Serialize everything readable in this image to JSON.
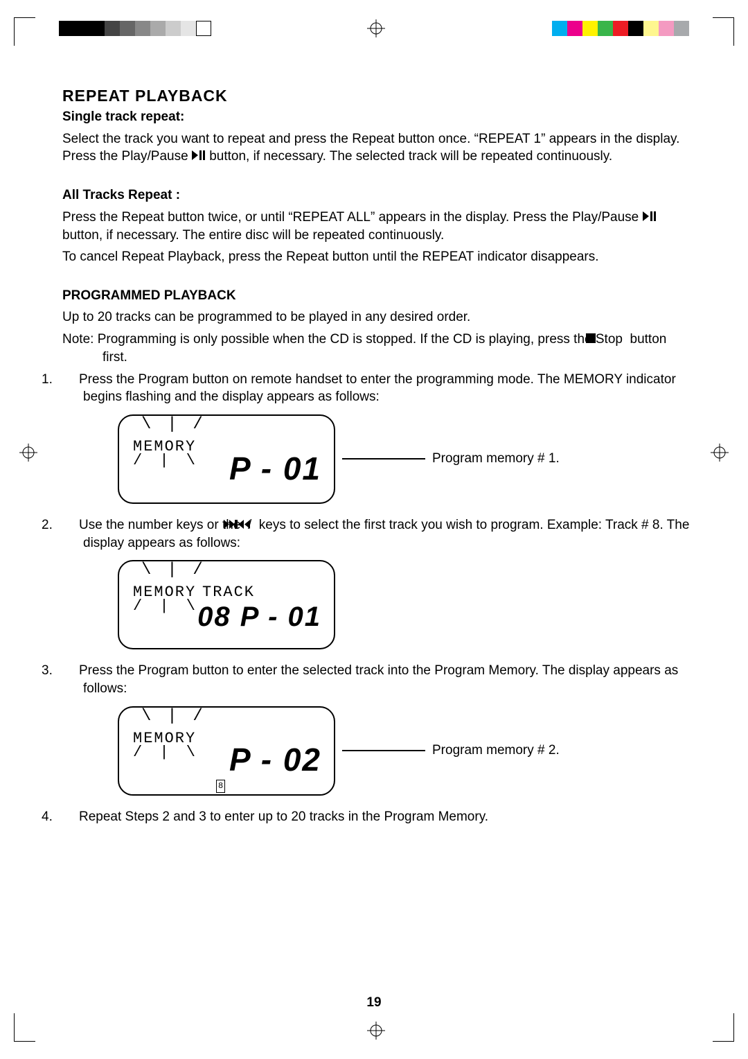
{
  "page_number": "19",
  "heading": "REPEAT PLAYBACK",
  "single": {
    "title": "Single track repeat:",
    "body_a": "Select the track you want to repeat and press the Repeat button once. “REPEAT 1” appears in the display.  Press the Play/Pause ",
    "body_b": " button, if necessary.  The selected track will be repeated continuously."
  },
  "all": {
    "title": "All Tracks Repeat :",
    "body_a": "Press the Repeat button twice, or until “REPEAT ALL” appears in the display. Press the Play/Pause ",
    "body_b": " button, if necessary.  The entire disc will be repeated continuously.",
    "cancel": "To cancel Repeat Playback, press the Repeat button until the REPEAT indicator disappears."
  },
  "prog": {
    "title": "PROGRAMMED PLAYBACK",
    "intro": "Up to 20 tracks can be programmed to be played in any desired order.",
    "note_a": "Note:  Programming is only possible when the CD is stopped. If the CD is playing, press the Stop ",
    "note_b": " button first.",
    "steps": [
      {
        "n": "1.",
        "text": "Press the Program button on remote handset to enter the programming mode.  The MEMORY indicator begins flashing and the display appears as follows:",
        "lcd": {
          "mem": "MEMORY",
          "readout": "P - 01",
          "caption": "Program memory # 1."
        }
      },
      {
        "n": "2.",
        "text_a": "Use the number keys or the ",
        "text_b": " / ",
        "text_c": " keys to select the first track you wish to program. Example:  Track # 8.  The display appears as follows:",
        "lcd": {
          "mem": "MEMORY",
          "track": "TRACK",
          "readout": "08 P - 01"
        }
      },
      {
        "n": "3.",
        "text": "Press the Program button to enter the selected track into the Program Memory. The display appears as follows:",
        "lcd": {
          "mem": "MEMORY",
          "readout": "P - 02",
          "sub": "8",
          "caption": "Program memory # 2."
        }
      },
      {
        "n": "4.",
        "text": "Repeat Steps 2 and 3 to enter up to 20 tracks in the Program Memory."
      }
    ]
  },
  "print_bars": {
    "left": [
      "#000",
      "#000",
      "#000",
      "#333",
      "#555",
      "#777",
      "#aaa",
      "#ccc",
      "#eee",
      "#fff"
    ],
    "right": [
      "#00aeef",
      "#ec008c",
      "#fff200",
      "#8dc63e",
      "#ed1c24",
      "#000000",
      "#fef200",
      "#f49ac1",
      "#a7a9ac"
    ]
  }
}
